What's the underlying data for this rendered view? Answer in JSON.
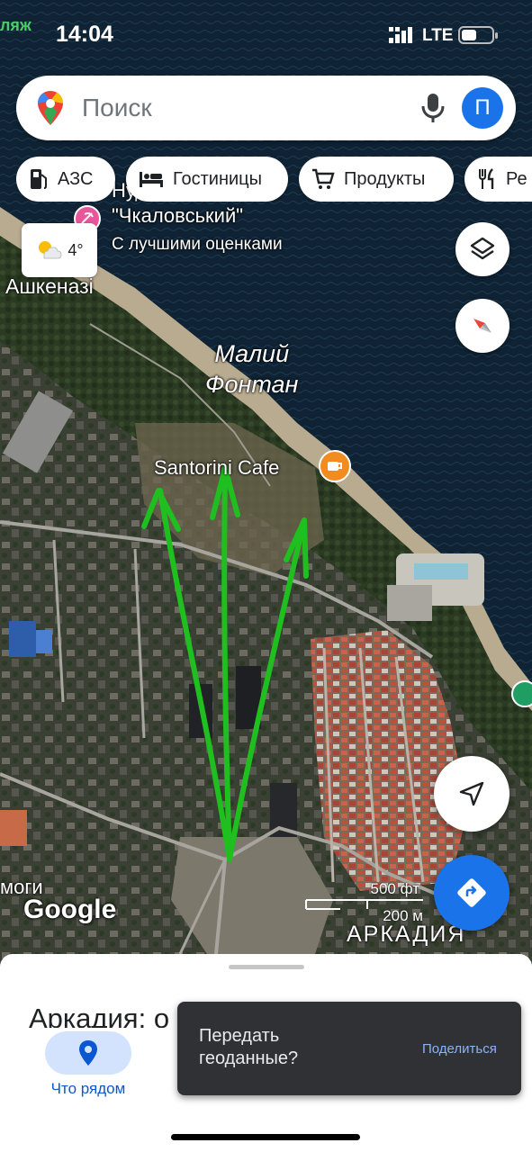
{
  "status_bar": {
    "time": "14:04",
    "network": "LTE",
    "left_clip": "ляж"
  },
  "search": {
    "placeholder": "Поиск",
    "avatar_letter": "П"
  },
  "chips": [
    {
      "label": "АЗС",
      "icon": "gas-station-icon"
    },
    {
      "label": "Гостиницы",
      "icon": "bed-icon"
    },
    {
      "label": "Продукты",
      "icon": "cart-icon"
    },
    {
      "label": "Ре",
      "icon": "restaurant-icon"
    }
  ],
  "weather": {
    "temp": "4°",
    "icon": "partly-sunny-icon"
  },
  "map_labels": {
    "beach_line1": "Нудистський пляж",
    "beach_line2": "\"Чкаловський\"",
    "beach_sub": "С лучшими оценками",
    "ashkenazi": "Ашкеназі",
    "area_line1": "Малий",
    "area_line2": "Фонтан",
    "cafe": "Santorini Cafe",
    "bottom_left": "моги",
    "arcadia": "АРКАДИЯ"
  },
  "attribution": "Google",
  "scale": {
    "feet": "500 фт",
    "meters": "200 м"
  },
  "sheet": {
    "title": "Аркадия: о"
  },
  "nav": {
    "nearby_label": "Что рядом"
  },
  "toast": {
    "message": "Передать геоданные?",
    "action": "Поделиться"
  },
  "colors": {
    "accent": "#1a73e8",
    "arrow": "#1fbf1f",
    "toast_bg": "#303134",
    "toast_action": "#8ab4f8",
    "cafe_pin": "#f28b20"
  }
}
